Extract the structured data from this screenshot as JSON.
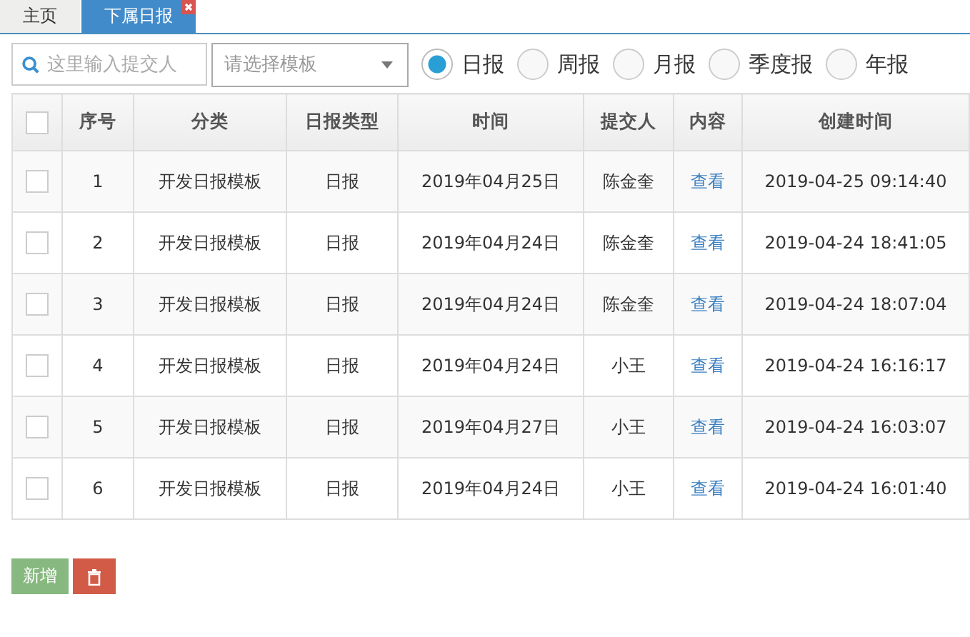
{
  "tabs": [
    {
      "label": "主页",
      "selected": false,
      "closable": false
    },
    {
      "label": "下属日报",
      "selected": true,
      "closable": true
    }
  ],
  "search": {
    "placeholder": "这里输入提交人"
  },
  "template_select": {
    "placeholder": "请选择模板"
  },
  "report_types": [
    {
      "label": "日报",
      "selected": true
    },
    {
      "label": "周报",
      "selected": false
    },
    {
      "label": "月报",
      "selected": false
    },
    {
      "label": "季度报",
      "selected": false
    },
    {
      "label": "年报",
      "selected": false
    }
  ],
  "table": {
    "header_checked": false,
    "columns": [
      "序号",
      "分类",
      "日报类型",
      "时间",
      "提交人",
      "内容",
      "创建时间"
    ],
    "rows": [
      {
        "checked": false,
        "cells": [
          "1",
          "开发日报模板",
          "日报",
          "2019年04月25日",
          "陈金奎",
          "查看",
          "2019-04-25 09:14:40"
        ]
      },
      {
        "checked": false,
        "cells": [
          "2",
          "开发日报模板",
          "日报",
          "2019年04月24日",
          "陈金奎",
          "查看",
          "2019-04-24 18:41:05"
        ]
      },
      {
        "checked": false,
        "cells": [
          "3",
          "开发日报模板",
          "日报",
          "2019年04月24日",
          "陈金奎",
          "查看",
          "2019-04-24 18:07:04"
        ]
      },
      {
        "checked": false,
        "cells": [
          "4",
          "开发日报模板",
          "日报",
          "2019年04月24日",
          "小王",
          "查看",
          "2019-04-24 16:16:17"
        ]
      },
      {
        "checked": false,
        "cells": [
          "5",
          "开发日报模板",
          "日报",
          "2019年04月27日",
          "小王",
          "查看",
          "2019-04-24 16:03:07"
        ]
      },
      {
        "checked": false,
        "cells": [
          "6",
          "开发日报模板",
          "日报",
          "2019年04月24日",
          "小王",
          "查看",
          "2019-04-24 16:01:40"
        ]
      }
    ]
  },
  "buttons": [
    {
      "kind": "add",
      "label": "新增"
    },
    {
      "kind": "delete"
    }
  ]
}
